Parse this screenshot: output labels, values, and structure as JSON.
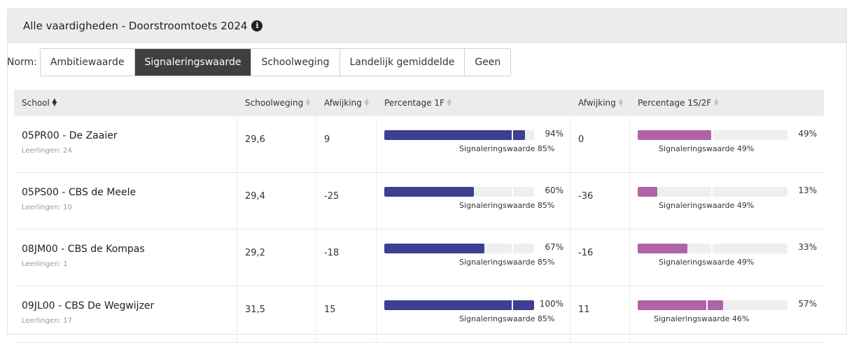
{
  "panel": {
    "title": "Alle vaardigheden - Doorstroomtoets 2024",
    "info_icon": "info-circle-icon"
  },
  "norm": {
    "label": "Norm:",
    "options": [
      "Ambitiewaarde",
      "Signaleringswaarde",
      "Schoolweging",
      "Landelijk gemiddelde",
      "Geen"
    ],
    "selected": "Signaleringswaarde"
  },
  "table": {
    "headers": {
      "school": "School",
      "schoolweging": "Schoolweging",
      "afwijking1": "Afwijking",
      "pct1f": "Percentage 1F",
      "afwijking2": "Afwijking",
      "pct2f": "Percentage 1S/2F"
    },
    "sort_icon": "sort-icon",
    "colors": {
      "bar_1f": "#3d3f92",
      "bar_1s2f": "#b063a8",
      "bar_track": "#efefef"
    },
    "rows": [
      {
        "school": "05PR00 - De Zaaier",
        "leerlingen": "Leerlingen: 24",
        "schoolweging": "29,6",
        "afwijking1": "9",
        "pct1f": 94,
        "pct1f_label": "94%",
        "sig1f": 85,
        "sig1f_label": "Signaleringswaarde 85%",
        "afwijking2": "0",
        "pct2f": 49,
        "pct2f_label": "49%",
        "sig2f": 49,
        "sig2f_label": "Signaleringswaarde 49%"
      },
      {
        "school": "05PS00 - CBS de Meele",
        "leerlingen": "Leerlingen: 10",
        "schoolweging": "29,4",
        "afwijking1": "-25",
        "pct1f": 60,
        "pct1f_label": "60%",
        "sig1f": 85,
        "sig1f_label": "Signaleringswaarde 85%",
        "afwijking2": "-36",
        "pct2f": 13,
        "pct2f_label": "13%",
        "sig2f": 49,
        "sig2f_label": "Signaleringswaarde 49%"
      },
      {
        "school": "08JM00 - CBS de Kompas",
        "leerlingen": "Leerlingen: 1",
        "schoolweging": "29,2",
        "afwijking1": "-18",
        "pct1f": 67,
        "pct1f_label": "67%",
        "sig1f": 85,
        "sig1f_label": "Signaleringswaarde 85%",
        "afwijking2": "-16",
        "pct2f": 33,
        "pct2f_label": "33%",
        "sig2f": 49,
        "sig2f_label": "Signaleringswaarde 49%"
      },
      {
        "school": "09JL00 - CBS De Wegwijzer",
        "leerlingen": "Leerlingen: 17",
        "schoolweging": "31,5",
        "afwijking1": "15",
        "pct1f": 100,
        "pct1f_label": "100%",
        "sig1f": 85,
        "sig1f_label": "Signaleringswaarde 85%",
        "afwijking2": "11",
        "pct2f": 57,
        "pct2f_label": "57%",
        "sig2f": 46,
        "sig2f_label": "Signaleringswaarde 46%"
      }
    ]
  }
}
